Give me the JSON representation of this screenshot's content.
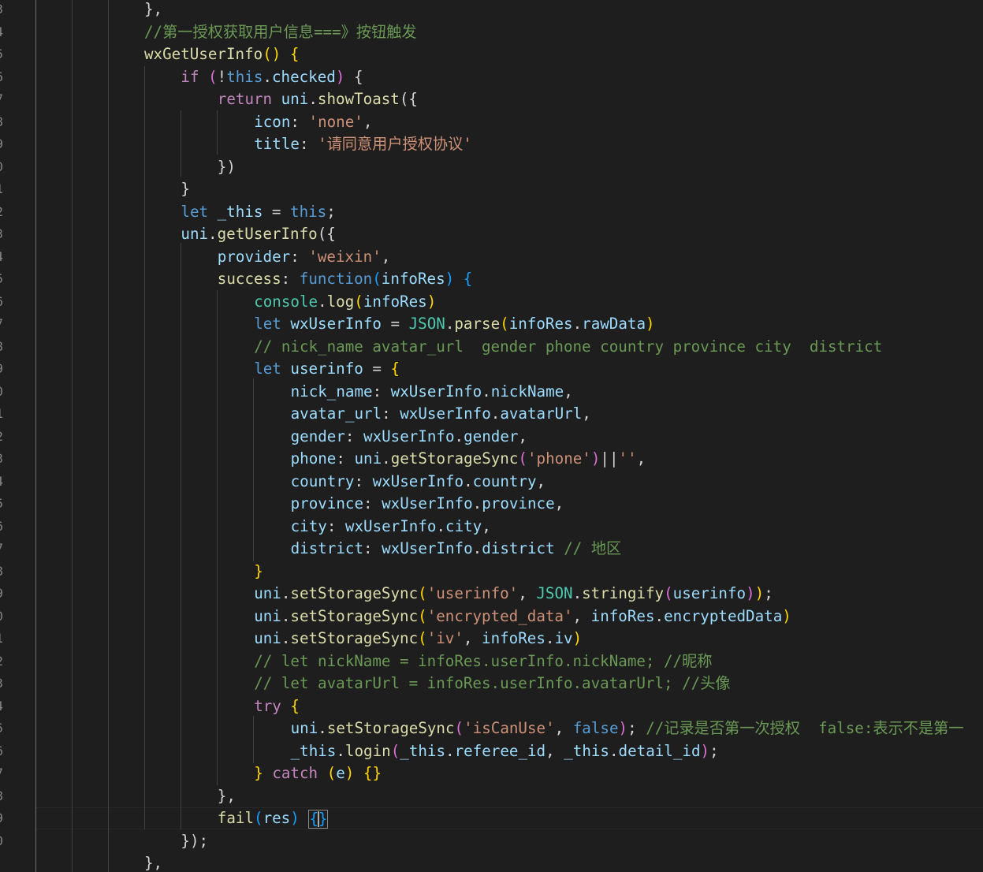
{
  "editor": {
    "line_numbers": [
      "3",
      "4",
      "5",
      "6",
      "7",
      "8",
      "9",
      "0",
      "1",
      "2",
      "3",
      "4",
      "5",
      "6",
      "7",
      "8",
      "9",
      "0",
      "1",
      "2",
      "3",
      "4",
      "5",
      "6",
      "7",
      "8",
      "9",
      "0",
      "1",
      "2",
      "3",
      "4",
      "5",
      "6",
      "7",
      "8",
      "9",
      "0"
    ],
    "lines": [
      [
        [
          "pun",
          "},"
        ]
      ],
      [
        [
          "cmt",
          "//第一授权获取用户信息===》按钮触发"
        ]
      ],
      [
        [
          "fn",
          "wxGetUserInfo"
        ],
        [
          "br1",
          "()"
        ],
        [
          "pun",
          " "
        ],
        [
          "br1",
          "{"
        ]
      ],
      [
        [
          "ctl",
          "if"
        ],
        [
          "pun",
          " "
        ],
        [
          "br2",
          "("
        ],
        [
          "pun",
          "!"
        ],
        [
          "kw",
          "this"
        ],
        [
          "pun",
          "."
        ],
        [
          "var",
          "checked"
        ],
        [
          "br2",
          ")"
        ],
        [
          "pun",
          " {"
        ]
      ],
      [
        [
          "ctl",
          "return"
        ],
        [
          "pun",
          " "
        ],
        [
          "var",
          "uni"
        ],
        [
          "pun",
          "."
        ],
        [
          "fn",
          "showToast"
        ],
        [
          "pun",
          "({"
        ]
      ],
      [
        [
          "prop",
          "icon"
        ],
        [
          "pun",
          ": "
        ],
        [
          "str",
          "'none'"
        ],
        [
          "pun",
          ","
        ]
      ],
      [
        [
          "prop",
          "title"
        ],
        [
          "pun",
          ": "
        ],
        [
          "str",
          "'请同意用户授权协议'"
        ]
      ],
      [
        [
          "pun",
          "})"
        ]
      ],
      [
        [
          "pun",
          "}"
        ]
      ],
      [
        [
          "kw",
          "let"
        ],
        [
          "pun",
          " "
        ],
        [
          "var",
          "_this"
        ],
        [
          "pun",
          " = "
        ],
        [
          "kw",
          "this"
        ],
        [
          "pun",
          ";"
        ]
      ],
      [
        [
          "var",
          "uni"
        ],
        [
          "pun",
          "."
        ],
        [
          "fn",
          "getUserInfo"
        ],
        [
          "pun",
          "({"
        ]
      ],
      [
        [
          "prop",
          "provider"
        ],
        [
          "pun",
          ": "
        ],
        [
          "str",
          "'weixin'"
        ],
        [
          "pun",
          ","
        ]
      ],
      [
        [
          "fn",
          "success"
        ],
        [
          "pun",
          ": "
        ],
        [
          "kw",
          "function"
        ],
        [
          "br3",
          "("
        ],
        [
          "var",
          "infoRes"
        ],
        [
          "br3",
          ")"
        ],
        [
          "pun",
          " "
        ],
        [
          "br3",
          "{"
        ]
      ],
      [
        [
          "cls",
          "console"
        ],
        [
          "pun",
          "."
        ],
        [
          "fn",
          "log"
        ],
        [
          "br1",
          "("
        ],
        [
          "var",
          "infoRes"
        ],
        [
          "br1",
          ")"
        ]
      ],
      [
        [
          "kw",
          "let"
        ],
        [
          "pun",
          " "
        ],
        [
          "var",
          "wxUserInfo"
        ],
        [
          "pun",
          " = "
        ],
        [
          "cls",
          "JSON"
        ],
        [
          "pun",
          "."
        ],
        [
          "fn",
          "parse"
        ],
        [
          "br1",
          "("
        ],
        [
          "var",
          "infoRes"
        ],
        [
          "pun",
          "."
        ],
        [
          "var",
          "rawData"
        ],
        [
          "br1",
          ")"
        ]
      ],
      [
        [
          "cmt",
          "// nick_name avatar_url  gender phone country province city  district"
        ]
      ],
      [
        [
          "kw",
          "let"
        ],
        [
          "pun",
          " "
        ],
        [
          "var",
          "userinfo"
        ],
        [
          "pun",
          " = "
        ],
        [
          "br1",
          "{"
        ]
      ],
      [
        [
          "prop",
          "nick_name"
        ],
        [
          "pun",
          ": "
        ],
        [
          "var",
          "wxUserInfo"
        ],
        [
          "pun",
          "."
        ],
        [
          "var",
          "nickName"
        ],
        [
          "pun",
          ","
        ]
      ],
      [
        [
          "prop",
          "avatar_url"
        ],
        [
          "pun",
          ": "
        ],
        [
          "var",
          "wxUserInfo"
        ],
        [
          "pun",
          "."
        ],
        [
          "var",
          "avatarUrl"
        ],
        [
          "pun",
          ","
        ]
      ],
      [
        [
          "prop",
          "gender"
        ],
        [
          "pun",
          ": "
        ],
        [
          "var",
          "wxUserInfo"
        ],
        [
          "pun",
          "."
        ],
        [
          "var",
          "gender"
        ],
        [
          "pun",
          ","
        ]
      ],
      [
        [
          "prop",
          "phone"
        ],
        [
          "pun",
          ": "
        ],
        [
          "var",
          "uni"
        ],
        [
          "pun",
          "."
        ],
        [
          "fn",
          "getStorageSync"
        ],
        [
          "br2",
          "("
        ],
        [
          "str",
          "'phone'"
        ],
        [
          "br2",
          ")"
        ],
        [
          "pun",
          "||"
        ],
        [
          "str",
          "''"
        ],
        [
          "pun",
          ","
        ]
      ],
      [
        [
          "prop",
          "country"
        ],
        [
          "pun",
          ": "
        ],
        [
          "var",
          "wxUserInfo"
        ],
        [
          "pun",
          "."
        ],
        [
          "var",
          "country"
        ],
        [
          "pun",
          ","
        ]
      ],
      [
        [
          "prop",
          "province"
        ],
        [
          "pun",
          ": "
        ],
        [
          "var",
          "wxUserInfo"
        ],
        [
          "pun",
          "."
        ],
        [
          "var",
          "province"
        ],
        [
          "pun",
          ","
        ]
      ],
      [
        [
          "prop",
          "city"
        ],
        [
          "pun",
          ": "
        ],
        [
          "var",
          "wxUserInfo"
        ],
        [
          "pun",
          "."
        ],
        [
          "var",
          "city"
        ],
        [
          "pun",
          ","
        ]
      ],
      [
        [
          "prop",
          "district"
        ],
        [
          "pun",
          ": "
        ],
        [
          "var",
          "wxUserInfo"
        ],
        [
          "pun",
          "."
        ],
        [
          "var",
          "district"
        ],
        [
          "pun",
          " "
        ],
        [
          "cmt",
          "// 地区"
        ]
      ],
      [
        [
          "br1",
          "}"
        ]
      ],
      [
        [
          "var",
          "uni"
        ],
        [
          "pun",
          "."
        ],
        [
          "fn",
          "setStorageSync"
        ],
        [
          "br1",
          "("
        ],
        [
          "str",
          "'userinfo'"
        ],
        [
          "pun",
          ", "
        ],
        [
          "cls",
          "JSON"
        ],
        [
          "pun",
          "."
        ],
        [
          "fn",
          "stringify"
        ],
        [
          "br2",
          "("
        ],
        [
          "var",
          "userinfo"
        ],
        [
          "br2",
          ")"
        ],
        [
          "br1",
          ")"
        ],
        [
          "pun",
          ";"
        ]
      ],
      [
        [
          "var",
          "uni"
        ],
        [
          "pun",
          "."
        ],
        [
          "fn",
          "setStorageSync"
        ],
        [
          "br1",
          "("
        ],
        [
          "str",
          "'encrypted_data'"
        ],
        [
          "pun",
          ", "
        ],
        [
          "var",
          "infoRes"
        ],
        [
          "pun",
          "."
        ],
        [
          "var",
          "encryptedData"
        ],
        [
          "br1",
          ")"
        ]
      ],
      [
        [
          "var",
          "uni"
        ],
        [
          "pun",
          "."
        ],
        [
          "fn",
          "setStorageSync"
        ],
        [
          "br1",
          "("
        ],
        [
          "str",
          "'iv'"
        ],
        [
          "pun",
          ", "
        ],
        [
          "var",
          "infoRes"
        ],
        [
          "pun",
          "."
        ],
        [
          "var",
          "iv"
        ],
        [
          "br1",
          ")"
        ]
      ],
      [
        [
          "cmt",
          "// let nickName = infoRes.userInfo.nickName; //昵称"
        ]
      ],
      [
        [
          "cmt",
          "// let avatarUrl = infoRes.userInfo.avatarUrl; //头像"
        ]
      ],
      [
        [
          "ctl",
          "try"
        ],
        [
          "pun",
          " "
        ],
        [
          "br1",
          "{"
        ]
      ],
      [
        [
          "var",
          "uni"
        ],
        [
          "pun",
          "."
        ],
        [
          "fn",
          "setStorageSync"
        ],
        [
          "br2",
          "("
        ],
        [
          "str",
          "'isCanUse'"
        ],
        [
          "pun",
          ", "
        ],
        [
          "kw",
          "false"
        ],
        [
          "br2",
          ")"
        ],
        [
          "pun",
          "; "
        ],
        [
          "cmt",
          "//记录是否第一次授权  false:表示不是第一"
        ]
      ],
      [
        [
          "var",
          "_this"
        ],
        [
          "pun",
          "."
        ],
        [
          "fn",
          "login"
        ],
        [
          "br2",
          "("
        ],
        [
          "var",
          "_this"
        ],
        [
          "pun",
          "."
        ],
        [
          "var",
          "referee_id"
        ],
        [
          "pun",
          ", "
        ],
        [
          "var",
          "_this"
        ],
        [
          "pun",
          "."
        ],
        [
          "var",
          "detail_id"
        ],
        [
          "br2",
          ")"
        ],
        [
          "pun",
          ";"
        ]
      ],
      [
        [
          "br1",
          "}"
        ],
        [
          "pun",
          " "
        ],
        [
          "ctl",
          "catch"
        ],
        [
          "pun",
          " "
        ],
        [
          "br1",
          "("
        ],
        [
          "var",
          "e"
        ],
        [
          "br1",
          ")"
        ],
        [
          "pun",
          " "
        ],
        [
          "br1",
          "{}"
        ]
      ],
      [
        [
          "pun",
          "},"
        ]
      ],
      [
        [
          "fn",
          "fail"
        ],
        [
          "br3",
          "("
        ],
        [
          "var",
          "res"
        ],
        [
          "br3",
          ")"
        ],
        [
          "pun",
          " "
        ]
      ],
      [
        [
          "pun",
          "});"
        ]
      ],
      [
        [
          "pun",
          "},"
        ]
      ]
    ],
    "cursor_text": "{}"
  }
}
